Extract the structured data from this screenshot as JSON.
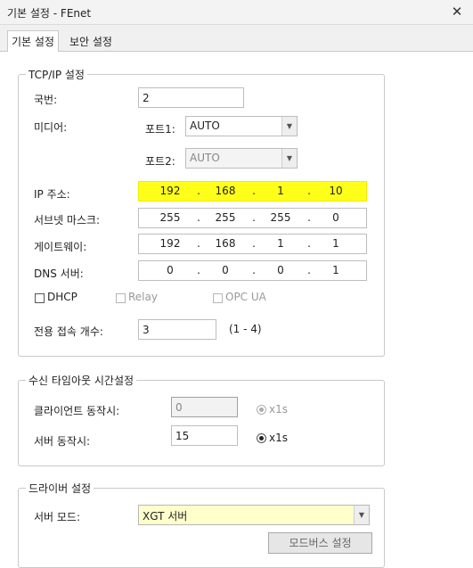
{
  "window": {
    "title": "기본 설정 - FEnet"
  },
  "tabs": [
    {
      "label": "기본 설정",
      "active": true
    },
    {
      "label": "보안 설정",
      "active": false
    }
  ],
  "tcpip": {
    "title": "TCP/IP 설정",
    "station_label": "국번:",
    "station_value": "2",
    "media_label": "미디어:",
    "port1_label": "포트1:",
    "port1_value": "AUTO",
    "port2_label": "포트2:",
    "port2_value": "AUTO",
    "ip_label": "IP 주소:",
    "ip": [
      "192",
      "168",
      "1",
      "10"
    ],
    "subnet_label": "서브넷 마스크:",
    "subnet": [
      "255",
      "255",
      "255",
      "0"
    ],
    "gateway_label": "게이트웨이:",
    "gateway": [
      "192",
      "168",
      "1",
      "1"
    ],
    "dns_label": "DNS 서버:",
    "dns": [
      "0",
      "0",
      "0",
      "1"
    ],
    "dot": ".",
    "dhcp_label": "DHCP",
    "relay_label": "Relay",
    "opcua_label": "OPC UA",
    "conn_label": "전용 접속 개수:",
    "conn_value": "3",
    "conn_range": "(1 - 4)"
  },
  "timeout": {
    "title": "수신 타임아웃 시간설정",
    "client_label": "클라이언트 동작시:",
    "client_value": "0",
    "client_unit": "x1s",
    "server_label": "서버 동작시:",
    "server_value": "15",
    "server_unit": "x1s"
  },
  "driver": {
    "title": "드라이버 설정",
    "mode_label": "서버 모드:",
    "mode_value": "XGT 서버",
    "modbus_button": "모드버스 설정"
  },
  "colors": {
    "highlight": "#ffff1a",
    "mode_select_bg": "#ffffcc"
  },
  "icons": {
    "close": "close-icon",
    "dropdown": "chevron-down-icon"
  }
}
